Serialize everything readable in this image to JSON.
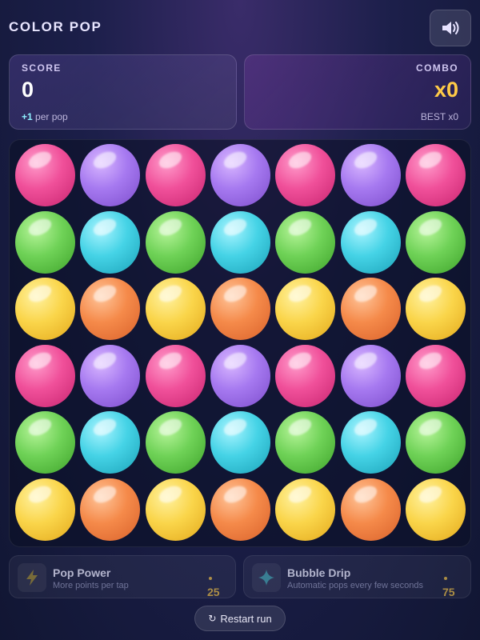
{
  "app": {
    "title": "COLOR POP"
  },
  "score": {
    "label": "SCORE",
    "value": "0",
    "per_pop_amount": "+1",
    "per_pop_suffix": " per pop"
  },
  "combo": {
    "label": "COMBO",
    "value": "x0",
    "best": "BEST x0"
  },
  "board": {
    "rows": [
      [
        "pink",
        "purple",
        "pink",
        "purple",
        "pink",
        "purple",
        "pink"
      ],
      [
        "green",
        "cyan",
        "green",
        "cyan",
        "green",
        "cyan",
        "green"
      ],
      [
        "yellow",
        "orange",
        "yellow",
        "orange",
        "yellow",
        "orange",
        "yellow"
      ],
      [
        "pink",
        "purple",
        "pink",
        "purple",
        "pink",
        "purple",
        "pink"
      ],
      [
        "green",
        "cyan",
        "green",
        "cyan",
        "green",
        "cyan",
        "green"
      ],
      [
        "yellow",
        "orange",
        "yellow",
        "orange",
        "yellow",
        "orange",
        "yellow"
      ]
    ],
    "colors": {
      "pink": [
        "#ff9ccb",
        "#f0509a",
        "#c8246f"
      ],
      "purple": [
        "#d8b6ff",
        "#a679f0",
        "#7d4dcc"
      ],
      "green": [
        "#b7f59a",
        "#6fd257",
        "#3ea32a"
      ],
      "cyan": [
        "#a8f4ff",
        "#45d3e6",
        "#1ba2b8"
      ],
      "yellow": [
        "#fff2a0",
        "#fad54a",
        "#e3a81b"
      ],
      "orange": [
        "#ffc59a",
        "#f58a4a",
        "#d9612a"
      ]
    }
  },
  "upgrades": [
    {
      "name": "Pop Power",
      "description": "More points per tap",
      "cost": "25",
      "icon": "lightning-icon"
    },
    {
      "name": "Bubble Drip",
      "description": "Automatic pops every few seconds",
      "cost": "75",
      "icon": "sparkle-icon"
    }
  ],
  "restart": {
    "label": "Restart run",
    "icon": "restart-icon"
  },
  "sound": {
    "icon": "speaker-icon"
  },
  "accent": {
    "combo_color": "#ffcb47",
    "highlight": "#8ef0ff",
    "cost_color": "#c7a348"
  }
}
